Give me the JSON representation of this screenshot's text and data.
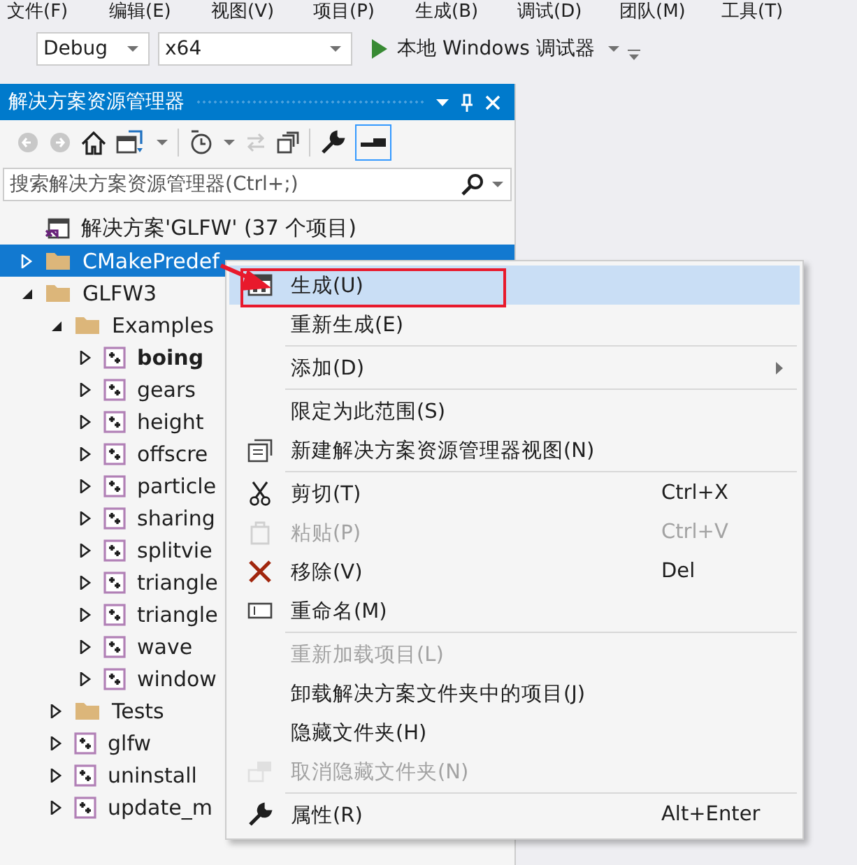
{
  "menu_bar": [
    "文件(F)",
    "编辑(E)",
    "视图(V)",
    "项目(P)",
    "生成(B)",
    "调试(D)",
    "团队(M)",
    "工具(T)"
  ],
  "toolbar": {
    "configuration": "Debug",
    "platform": "x64",
    "debugger": "本地 Windows 调试器"
  },
  "solution_explorer": {
    "title": "解决方案资源管理器",
    "search": {
      "placeholder": "搜索解决方案资源管理器(Ctrl+;)"
    },
    "solution": "解决方案'GLFW' (37 个项目)",
    "tree": [
      {
        "label": "CMakePredef",
        "kind": "folder",
        "expanded": false,
        "selected": true
      },
      {
        "label": "GLFW3",
        "kind": "folder",
        "expanded": true,
        "selected": false,
        "children": [
          {
            "label": "Examples",
            "kind": "folder",
            "expanded": true,
            "selected": false,
            "children": [
              {
                "label": "boing",
                "kind": "project",
                "expanded": false,
                "selected": false,
                "startup": true
              },
              {
                "label": "gears",
                "kind": "project",
                "expanded": false,
                "selected": false,
                "startup": false
              },
              {
                "label": "height",
                "kind": "project",
                "expanded": false,
                "selected": false,
                "startup": false
              },
              {
                "label": "offscre",
                "kind": "project",
                "expanded": false,
                "selected": false,
                "startup": false
              },
              {
                "label": "particle",
                "kind": "project",
                "expanded": false,
                "selected": false,
                "startup": false
              },
              {
                "label": "sharing",
                "kind": "project",
                "expanded": false,
                "selected": false,
                "startup": false
              },
              {
                "label": "splitvie",
                "kind": "project",
                "expanded": false,
                "selected": false,
                "startup": false
              },
              {
                "label": "triangle",
                "kind": "project",
                "expanded": false,
                "selected": false,
                "startup": false
              },
              {
                "label": "triangle",
                "kind": "project",
                "expanded": false,
                "selected": false,
                "startup": false
              },
              {
                "label": "wave",
                "kind": "project",
                "expanded": false,
                "selected": false,
                "startup": false
              },
              {
                "label": "window",
                "kind": "project",
                "expanded": false,
                "selected": false,
                "startup": false
              }
            ]
          },
          {
            "label": "Tests",
            "kind": "folder",
            "expanded": false,
            "selected": false
          },
          {
            "label": "glfw",
            "kind": "project",
            "expanded": false,
            "selected": false,
            "startup": false
          },
          {
            "label": "uninstall",
            "kind": "project",
            "expanded": false,
            "selected": false,
            "startup": false
          },
          {
            "label": "update_m",
            "kind": "project",
            "expanded": false,
            "selected": false,
            "startup": false
          }
        ]
      }
    ]
  },
  "context_menu": [
    {
      "kind": "item",
      "label": "生成(U)",
      "selected": true,
      "disabled": false
    },
    {
      "kind": "item",
      "label": "重新生成(E)",
      "selected": false,
      "disabled": false
    },
    {
      "kind": "separator"
    },
    {
      "kind": "item",
      "label": "添加(D)",
      "selected": false,
      "disabled": false,
      "submenu": true
    },
    {
      "kind": "separator"
    },
    {
      "kind": "item",
      "label": "限定为此范围(S)",
      "selected": false,
      "disabled": false
    },
    {
      "kind": "item",
      "label": "新建解决方案资源管理器视图(N)",
      "selected": false,
      "disabled": false
    },
    {
      "kind": "separator"
    },
    {
      "kind": "item",
      "label": "剪切(T)",
      "shortcut": "Ctrl+X",
      "selected": false,
      "disabled": false
    },
    {
      "kind": "item",
      "label": "粘贴(P)",
      "shortcut": "Ctrl+V",
      "selected": false,
      "disabled": true
    },
    {
      "kind": "item",
      "label": "移除(V)",
      "shortcut": "Del",
      "selected": false,
      "disabled": false
    },
    {
      "kind": "item",
      "label": "重命名(M)",
      "selected": false,
      "disabled": false
    },
    {
      "kind": "separator"
    },
    {
      "kind": "item",
      "label": "重新加载项目(L)",
      "selected": false,
      "disabled": true
    },
    {
      "kind": "item",
      "label": "卸载解决方案文件夹中的项目(J)",
      "selected": false,
      "disabled": false
    },
    {
      "kind": "item",
      "label": "隐藏文件夹(H)",
      "selected": false,
      "disabled": false
    },
    {
      "kind": "item",
      "label": "取消隐藏文件夹(N)",
      "selected": false,
      "disabled": true
    },
    {
      "kind": "separator"
    },
    {
      "kind": "item",
      "label": "属性(R)",
      "shortcut": "Alt+Enter",
      "selected": false,
      "disabled": false
    }
  ]
}
